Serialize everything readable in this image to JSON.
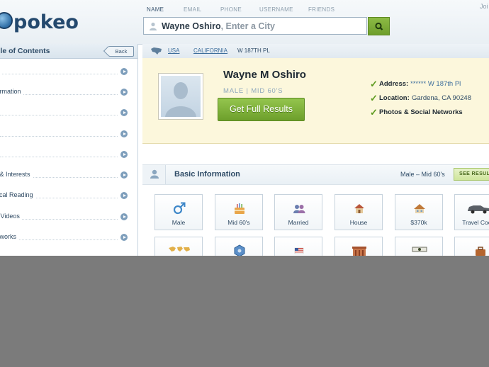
{
  "header": {
    "logo": "pokeo",
    "tabs": [
      "NAME",
      "EMAIL",
      "PHONE",
      "USERNAME",
      "FRIENDS"
    ],
    "active_tab": "NAME",
    "join_label": "Joi",
    "search_name": "Wayne Oshiro",
    "search_hint": ", Enter a City"
  },
  "sidebar": {
    "title": "ble of Contents",
    "back_label": "Back",
    "items": [
      "ry",
      "formation",
      "y",
      "",
      "",
      "e & Interests",
      "gical Reading",
      "& Videos",
      "etworks"
    ]
  },
  "breadcrumb": {
    "country": "USA",
    "state": "CALIFORNIA",
    "street": "W 187TH PL"
  },
  "profile": {
    "name": "Wayne M Oshiro",
    "subtitle": "MALE | MID 60'S",
    "get_results": "Get Full Results",
    "address_label": "Address:",
    "address_value": "****** W 187th Pl",
    "location_label": "Location:",
    "location_value": "Gardena, CA 90248",
    "photos_label": "Photos & Social Networks"
  },
  "basic_info": {
    "title": "Basic Information",
    "summary": "Male – Mid 60's",
    "see_results": "SEE RESULT",
    "tiles": [
      {
        "label": "Male",
        "icon": "male-symbol-icon"
      },
      {
        "label": "Mid 60's",
        "icon": "birthday-cake-icon"
      },
      {
        "label": "Married",
        "icon": "couple-icon"
      },
      {
        "label": "House",
        "icon": "house-icon"
      },
      {
        "label": "$370k",
        "icon": "house-value-icon"
      },
      {
        "label": "Travel Cook",
        "icon": "car-icon"
      },
      {
        "label": "",
        "icon": "world-map-icon"
      },
      {
        "label": "",
        "icon": "zodiac-badge-icon"
      },
      {
        "label": "",
        "icon": "us-flag-icon"
      },
      {
        "label": "",
        "icon": "building-icon"
      },
      {
        "label": "",
        "icon": "money-icon"
      },
      {
        "label": "",
        "icon": "briefcase-icon"
      }
    ]
  },
  "colors": {
    "brand": "#24496e",
    "accent_green": "#7aac34",
    "highlight_bg": "#fcf7dc",
    "overlay": "#7b7b7b"
  }
}
